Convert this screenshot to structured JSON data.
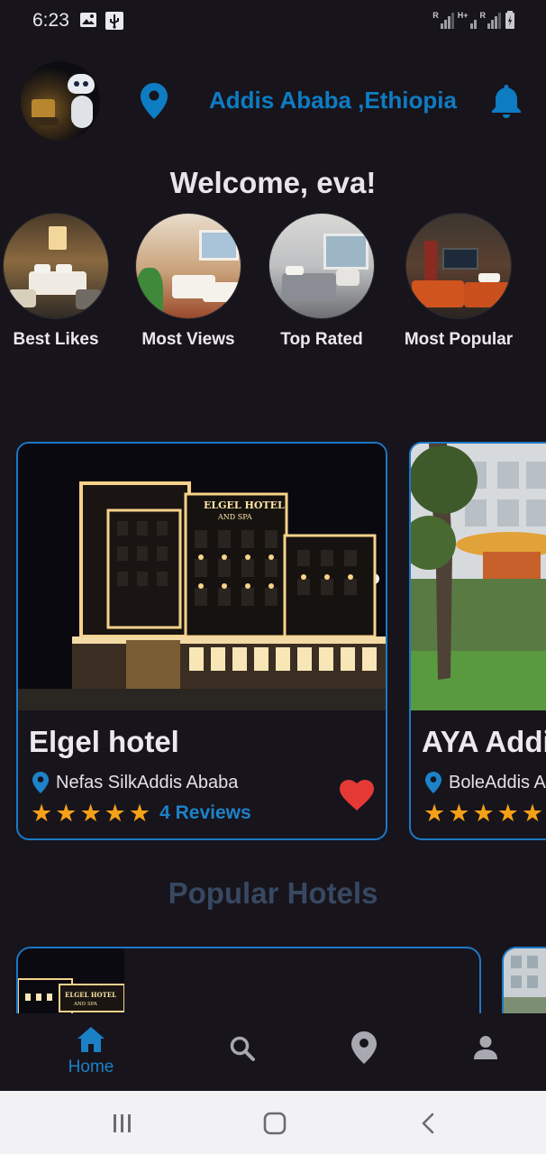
{
  "status_bar": {
    "time": "6:23",
    "sig1_label": "R",
    "sig2_label": "H+",
    "sig3_label": "R"
  },
  "header": {
    "location": "Addis Ababa ,Ethiopia",
    "avatar_icon": "user-avatar",
    "pin_icon": "location-pin-icon",
    "bell_icon": "bell-icon",
    "accent_color": "#0e7cc2"
  },
  "welcome": "Welcome, eva!",
  "categories": [
    {
      "label": "Best Likes"
    },
    {
      "label": "Most Views"
    },
    {
      "label": "Top Rated"
    },
    {
      "label": "Most Popular"
    }
  ],
  "hotels": [
    {
      "name": "Elgel hotel",
      "location": "Nefas SilkAddis Ababa",
      "stars": 5,
      "reviews": "4 Reviews",
      "sign": "ELGEL HOTEL",
      "sign2": "AND SPA"
    },
    {
      "name": "AYA Addis",
      "location": "BoleAddis Ababa",
      "stars": 4.5
    }
  ],
  "popular_title": "Popular Hotels",
  "popular_cards": [
    {
      "sign": "ELGEL HOTEL",
      "sign2": "AND SPA"
    }
  ],
  "bottom_nav": {
    "home_label": "Home",
    "active": "home",
    "icons": [
      "home-icon",
      "search-icon",
      "location-icon",
      "profile-icon"
    ]
  },
  "colors": {
    "background": "#17141c",
    "accent": "#1d78c4",
    "star": "#f5a117",
    "heart": "#e53935"
  }
}
